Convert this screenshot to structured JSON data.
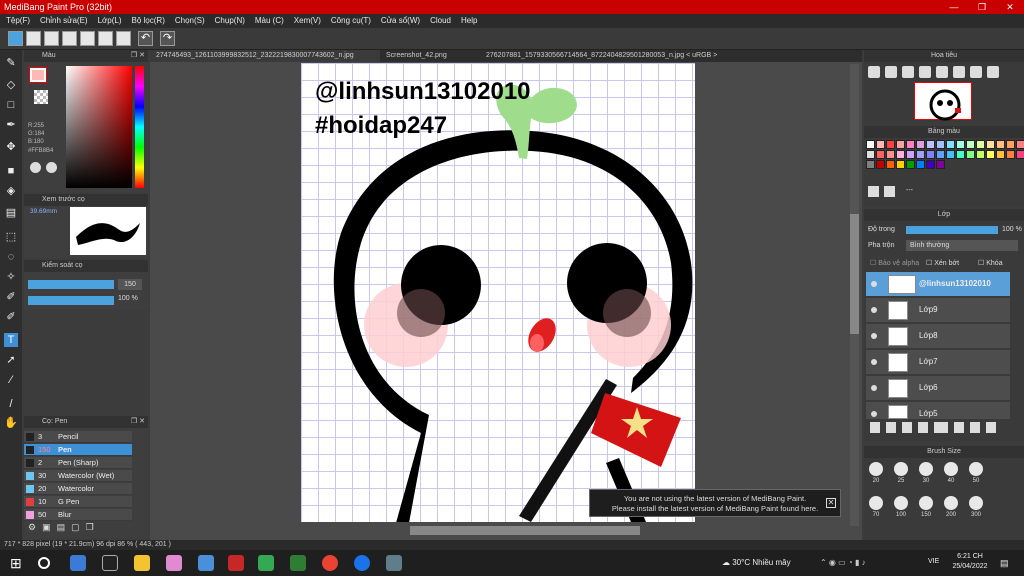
{
  "window": {
    "title": "MediBang Paint Pro (32bit)",
    "controls": [
      "—",
      "❐",
      "✕"
    ]
  },
  "menu": [
    "Tệp(F)",
    "Chỉnh sửa(E)",
    "Lớp(L)",
    "Bộ lọc(R)",
    "Chọn(S)",
    "Chụp(N)",
    "Màu (C)",
    "Xem(V)",
    "Công cụ(T)",
    "Cửa sổ(W)",
    "Cloud",
    "Help"
  ],
  "left_panels": {
    "color": {
      "title": "Màu",
      "r": "R:255",
      "g": "G:184",
      "b": "B:180",
      "hex": "#FFB8B4",
      "fg_color": "#ffb8b4"
    },
    "preview": {
      "title": "Xem trước cọ",
      "size": "39.69mm"
    },
    "brush_control": {
      "title": "Kiểm soát cọ",
      "size_value": "150",
      "opacity_value": "100 %"
    },
    "brush_list": {
      "title": "Cọ: Pen",
      "items": [
        {
          "size": "3",
          "name": "Pencil",
          "color": "#222222"
        },
        {
          "size": "150",
          "name": "Pen",
          "color": "#222222",
          "selected": true
        },
        {
          "size": "2",
          "name": "Pen (Sharp)",
          "color": "#222222"
        },
        {
          "size": "30",
          "name": "Watercolor (Wet)",
          "color": "#6cc6f0"
        },
        {
          "size": "20",
          "name": "Watercolor",
          "color": "#6cc6f0"
        },
        {
          "size": "10",
          "name": "G Pen",
          "color": "#e04040"
        },
        {
          "size": "50",
          "name": "Blur",
          "color": "#f0a0e0"
        }
      ]
    }
  },
  "tabs": [
    "274745493_1261103999832512_2322219830007743602_n.jpg",
    "Screenshot_42.png",
    "276207881_1579330566714564_8722404829501280053_n.jpg < uRGB >"
  ],
  "canvas": {
    "text_line1": "@linhsun13102010",
    "text_line2": "#hoidap247"
  },
  "right_panels": {
    "navigator": {
      "title": "Hoa tiêu"
    },
    "palette": {
      "title": "Bảng màu",
      "dash": "---",
      "swatches": [
        "#ffffff",
        "#ffb8b4",
        "#ff4040",
        "#ffa0a0",
        "#ff80c0",
        "#e0a0e0",
        "#c0c0ff",
        "#a0c0ff",
        "#80e0ff",
        "#a0ffe0",
        "#c0ffc0",
        "#e0ffa0",
        "#ffe0a0",
        "#ffc080",
        "#ffa060",
        "#ff8080",
        "#e0e0e0",
        "#ff6060",
        "#ff9090",
        "#ffb0e0",
        "#d0a0ff",
        "#a0a0ff",
        "#8080ff",
        "#60a0ff",
        "#40c0ff",
        "#40ffc0",
        "#80ff80",
        "#c0ff60",
        "#ffff60",
        "#ffc040",
        "#ff8040",
        "#ff4080",
        "#808080",
        "#c00000",
        "#ff6000",
        "#ffd000",
        "#00a000",
        "#0080ff",
        "#4000c0",
        "#8000a0"
      ]
    },
    "layer": {
      "title": "Lớp",
      "opacity_label": "Độ trong",
      "opacity_value": "100 %",
      "blend_label": "Pha trộn",
      "blend_value": "Bình thường",
      "protect_alpha": "Bảo vệ alpha",
      "clipping": "Xén bớt",
      "lock": "Khóa",
      "items": [
        "@linhsun13102010",
        "Lớp9",
        "Lớp8",
        "Lớp7",
        "Lớp6",
        "Lớp5"
      ]
    },
    "brush_size": {
      "title": "Brush Size",
      "sizes": [
        "20",
        "25",
        "30",
        "40",
        "50",
        "70",
        "100",
        "150",
        "200",
        "300"
      ]
    }
  },
  "status": {
    "text": "717 * 828 pixel  (19 * 21.9cm)  96 dpi  86 %  ( 443, 201 )"
  },
  "toast": {
    "line1": "You are not using the latest version of MediBang Paint.",
    "line2": "Please install the latest version of MediBang Paint found here."
  },
  "taskbar": {
    "weather": "30°C  Nhiều mây",
    "lang": "VIE",
    "time": "6:21 CH",
    "date": "25/04/2022"
  }
}
